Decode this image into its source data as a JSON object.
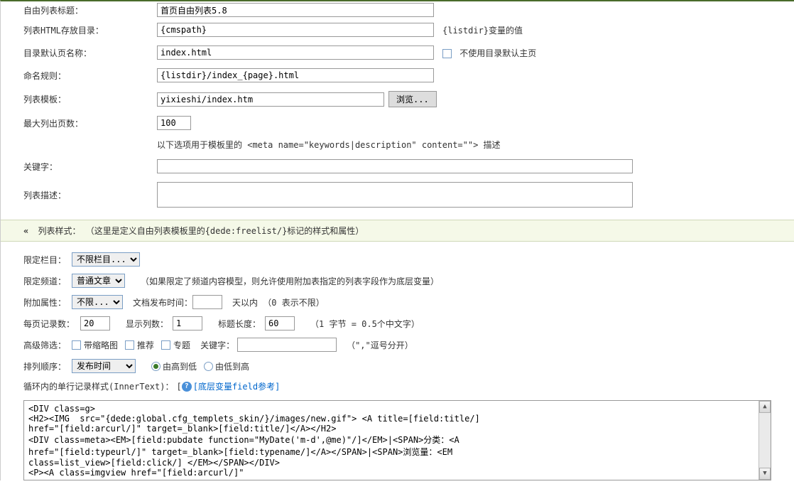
{
  "top": {
    "title_label": "自由列表标题：",
    "title_value": "首页自由列表5.8",
    "html_dir_label": "列表HTML存放目录：",
    "html_dir_value": "{cmspath}",
    "html_dir_note": "{listdir}变量的值",
    "default_page_label": "目录默认页名称：",
    "default_page_value": "index.html",
    "no_default_checkbox": "不使用目录默认主页",
    "naming_label": "命名规则：",
    "naming_value": "{listdir}/index_{page}.html",
    "template_label": "列表模板：",
    "template_value": "yixieshi/index.htm",
    "browse_btn": "浏览...",
    "max_pages_label": "最大列出页数：",
    "max_pages_value": "100",
    "meta_note": "以下选项用于模板里的 <meta name=\"keywords|description\" content=\"\"> 描述",
    "keywords_label": "关键字：",
    "keywords_value": "",
    "desc_label": "列表描述：",
    "desc_value": ""
  },
  "section_header": "列表样式： （这里是定义自由列表模板里的{dede:freelist/}标记的样式和属性）",
  "form2": {
    "limit_cat_label": "限定栏目：",
    "limit_cat_select": "不限栏目...",
    "limit_channel_label": "限定频道：",
    "limit_channel_select": "普通文章",
    "limit_channel_note": "（如果限定了频道内容模型，则允许使用附加表指定的列表字段作为底层变量）",
    "attr_label": "附加属性：",
    "attr_select": "不限...",
    "pub_time_label": "文档发布时间：",
    "pub_time_value": "",
    "pub_time_suffix": "天以内 （0 表示不限）",
    "per_page_label": "每页记录数：",
    "per_page_value": "20",
    "cols_label": "显示列数：",
    "cols_value": "1",
    "title_len_label": "标题长度：",
    "title_len_value": "60",
    "title_len_note": "（1 字节 = 0.5个中文字）",
    "adv_filter_label": "高级筛选：",
    "cb_thumb": "带缩略图",
    "cb_recommend": "推荐",
    "cb_special": "专题",
    "kw_label": "关键字：",
    "kw_value": "",
    "kw_note": "（\",\"逗号分开）",
    "sort_label": "排列顺序：",
    "sort_select": "发布时间",
    "sort_desc": "由高到低",
    "sort_asc": "由低到高",
    "innertext_label": "循环内的单行记录样式(InnerText)：",
    "innertext_link": "[底层变量field参考]",
    "code": "<DIV class=g>\n<H2><IMG  src=\"{dede:global.cfg_templets_skin/}/images/new.gif\"> <A title=[field:title/]\nhref=\"[field:arcurl/]\" target=_blank>[field:title/]</A></H2>\n<DIV class=meta><EM>[field:pubdate function=\"MyDate('m-d',@me)\"/]</EM>|<SPAN>分类：<A\nhref=\"[field:typeurl/]\" target=_blank>[field:typename/]</A></SPAN>|<SPAN>浏览量：<EM\nclass=list_view>[field:click/] </EM></SPAN></DIV>\n<P><A class=imgview href=\"[field:arcurl/]\"\ntarget=_blank><IMG  align=right"
  }
}
